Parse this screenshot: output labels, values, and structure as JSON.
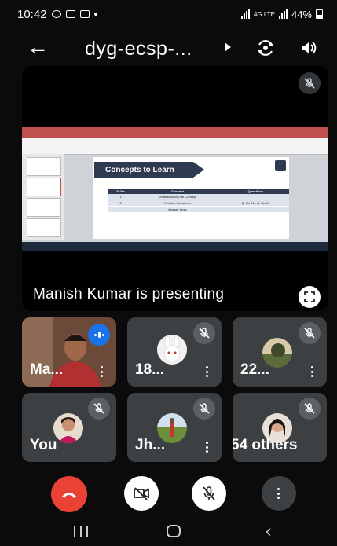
{
  "status_bar": {
    "time": "10:42",
    "network": "4G LTE",
    "battery": "44%"
  },
  "header": {
    "meeting_code": "dyg-ecsp-..."
  },
  "stage": {
    "presenter_text": "Manish Kumar is presenting",
    "slide": {
      "title": "Concepts to Learn",
      "columns": [
        "Sr.No",
        "Concept",
        "Questions"
      ],
      "rows": [
        [
          "1",
          "Understanding the Concept",
          ""
        ],
        [
          "2",
          "Practice Questions",
          "Q. No 01 - Q. No 10"
        ],
        [
          "",
          "Answer Keys",
          ""
        ]
      ]
    }
  },
  "participants": [
    {
      "name": "Ma...",
      "muted": false,
      "speaking": true
    },
    {
      "name": "18...",
      "muted": true
    },
    {
      "name": "22...",
      "muted": true
    },
    {
      "name": "You",
      "muted": true
    },
    {
      "name": "Jh...",
      "muted": true
    },
    {
      "name": "54 others",
      "muted": true
    }
  ],
  "controls": {
    "end_call": "end-call",
    "camera": "camera-off",
    "mic": "mic-off",
    "more": "more-options"
  },
  "colors": {
    "end_call": "#ea4335",
    "tile_bg": "#3c4043",
    "speaking": "#1a73e8"
  }
}
